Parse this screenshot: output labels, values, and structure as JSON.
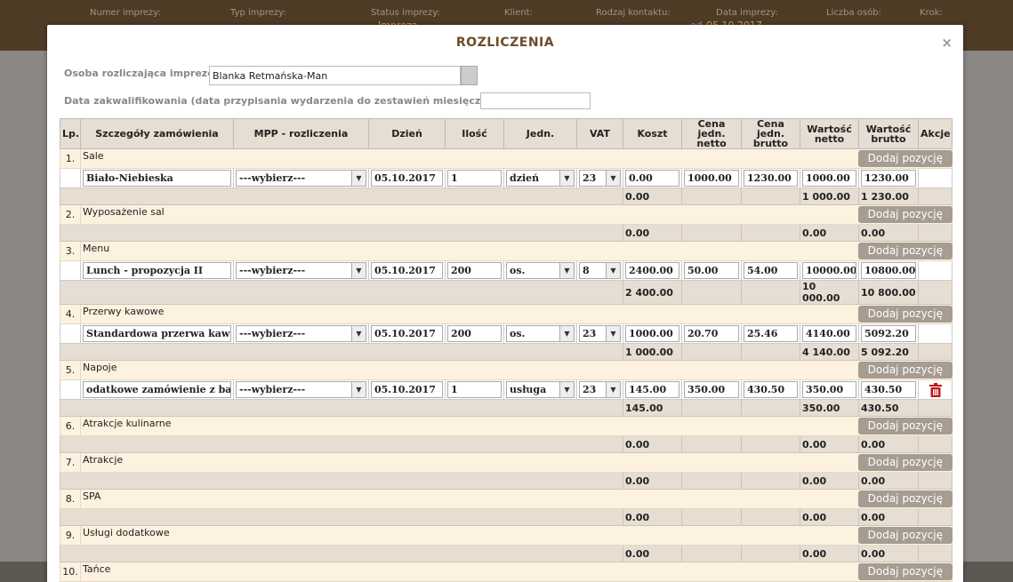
{
  "background": {
    "labels": [
      "Numer imprezy:",
      "Typ imprezy:",
      "Status imprezy:",
      "Klient:",
      "Rodzaj kontaktu:",
      "Data imprezy:",
      "Liczba osób:",
      "Krok:"
    ],
    "status_value": "Impreza",
    "date_value": "05.10.2017",
    "date_prefix": "od"
  },
  "modal": {
    "title": "ROZLICZENIA",
    "close": "×",
    "person_label": "Osoba rozliczająca imprezę:",
    "person_value": "Blanka Retmańska-Man",
    "date_label": "Data zakwalifikowania (data przypisania wydarzenia do zestawień miesięcznych):",
    "date_value": ""
  },
  "table": {
    "headers": [
      "Lp.",
      "Szczegóły zamówienia",
      "MPP - rozliczenia",
      "Dzień",
      "Ilość",
      "Jedn.",
      "VAT",
      "Koszt",
      "Cena jedn. netto",
      "Cena jedn. brutto",
      "Wartość netto",
      "Wartość brutto",
      "Akcje"
    ],
    "add_label": "Dodaj pozycję",
    "sections": [
      {
        "num": "1.",
        "name": "Sale",
        "items": [
          {
            "name": "Biało-Niebieska",
            "mpp": "---wybierz---",
            "day": "05.10.2017",
            "qty": "1",
            "unit": "dzień",
            "vat": "23",
            "cost": "0.00",
            "net_unit": "1000.00",
            "gross_unit": "1230.00",
            "net": "1000.00",
            "gross": "1230.00",
            "trash": false
          }
        ],
        "sum": {
          "cost": "0.00",
          "net": "1 000.00",
          "gross": "1 230.00"
        }
      },
      {
        "num": "2.",
        "name": "Wyposażenie sal",
        "items": [],
        "sum": {
          "cost": "0.00",
          "net": "0.00",
          "gross": "0.00"
        }
      },
      {
        "num": "3.",
        "name": "Menu",
        "items": [
          {
            "name": "Lunch - propozycja II",
            "mpp": "---wybierz---",
            "day": "05.10.2017",
            "qty": "200",
            "unit": "os.",
            "vat": "8",
            "cost": "2400.00",
            "net_unit": "50.00",
            "gross_unit": "54.00",
            "net": "10000.00",
            "gross": "10800.00",
            "trash": false
          }
        ],
        "sum": {
          "cost": "2 400.00",
          "net": "10 000.00",
          "gross": "10 800.00"
        }
      },
      {
        "num": "4.",
        "name": "Przerwy kawowe",
        "items": [
          {
            "name": "Standardowa przerwa kawowa",
            "mpp": "---wybierz---",
            "day": "05.10.2017",
            "qty": "200",
            "unit": "os.",
            "vat": "23",
            "cost": "1000.00",
            "net_unit": "20.70",
            "gross_unit": "25.46",
            "net": "4140.00",
            "gross": "5092.20",
            "trash": false
          }
        ],
        "sum": {
          "cost": "1 000.00",
          "net": "4 140.00",
          "gross": "5 092.20"
        }
      },
      {
        "num": "5.",
        "name": "Napoje",
        "items": [
          {
            "name": "odatkowe zamówienie z baru",
            "mpp": "---wybierz---",
            "day": "05.10.2017",
            "qty": "1",
            "unit": "usługa",
            "vat": "23",
            "cost": "145.00",
            "net_unit": "350.00",
            "gross_unit": "430.50",
            "net": "350.00",
            "gross": "430.50",
            "trash": true
          }
        ],
        "sum": {
          "cost": "145.00",
          "net": "350.00",
          "gross": "430.50"
        }
      },
      {
        "num": "6.",
        "name": "Atrakcje kulinarne",
        "items": [],
        "sum": {
          "cost": "0.00",
          "net": "0.00",
          "gross": "0.00"
        }
      },
      {
        "num": "7.",
        "name": "Atrakcje",
        "items": [],
        "sum": {
          "cost": "0.00",
          "net": "0.00",
          "gross": "0.00"
        }
      },
      {
        "num": "8.",
        "name": "SPA",
        "items": [],
        "sum": {
          "cost": "0.00",
          "net": "0.00",
          "gross": "0.00"
        }
      },
      {
        "num": "9.",
        "name": "Usługi dodatkowe",
        "items": [],
        "sum": {
          "cost": "0.00",
          "net": "0.00",
          "gross": "0.00"
        }
      },
      {
        "num": "10.",
        "name": "Tańce",
        "items": [],
        "sum": {
          "cost": "0.00",
          "net": "0.00",
          "gross": "0.00"
        }
      }
    ]
  },
  "colors": {
    "header_bg": "#e6ddd3",
    "category_bg": "#fdf1df",
    "button_bg": "#a69c91",
    "title": "#6b4c2c",
    "trash": "#c0141b"
  }
}
